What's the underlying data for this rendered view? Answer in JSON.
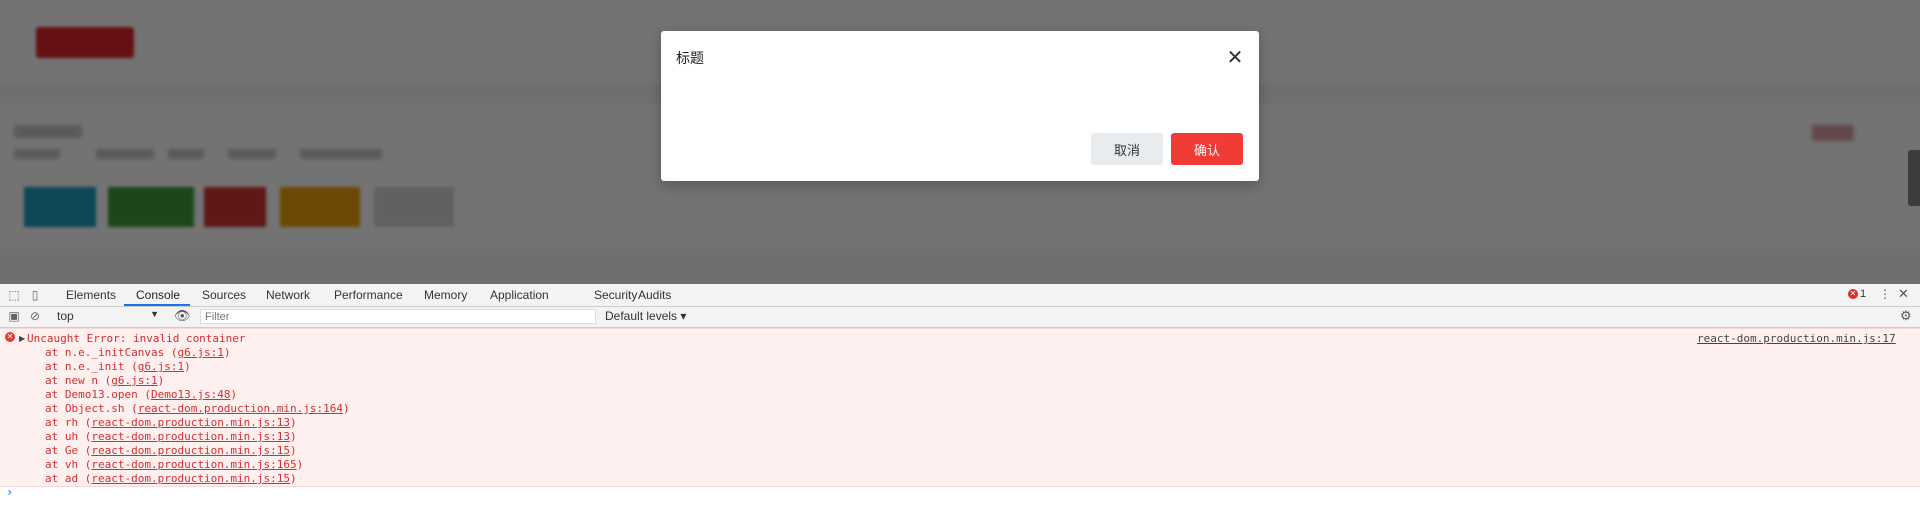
{
  "modal": {
    "title": "标题",
    "close_icon": "close-icon",
    "cancel_label": "取消",
    "ok_label": "确认",
    "ok_color": "#f03b36"
  },
  "devtools": {
    "tabs": [
      "Elements",
      "Console",
      "Sources",
      "Network",
      "Performance",
      "Memory",
      "Application",
      "Security",
      "Audits"
    ],
    "active_tab": "Console",
    "error_count": "1",
    "context": "top",
    "filter_placeholder": "Filter",
    "levels": "Default levels ▾",
    "error": {
      "message": "Uncaught Error: invalid container",
      "source": "react-dom.production.min.js:17",
      "stack": [
        {
          "prefix": "at n.e._initCanvas (",
          "link": "g6.js:1",
          "suffix": ")"
        },
        {
          "prefix": "at n.e._init (",
          "link": "g6.js:1",
          "suffix": ")"
        },
        {
          "prefix": "at new n (",
          "link": "g6.js:1",
          "suffix": ")"
        },
        {
          "prefix": "at Demo13.open (",
          "link": "Demo13.js:48",
          "suffix": ")"
        },
        {
          "prefix": "at Object.sh (",
          "link": "react-dom.production.min.js:164",
          "suffix": ")"
        },
        {
          "prefix": "at rh (",
          "link": "react-dom.production.min.js:13",
          "suffix": ")"
        },
        {
          "prefix": "at uh (",
          "link": "react-dom.production.min.js:13",
          "suffix": ")"
        },
        {
          "prefix": "at Ge (",
          "link": "react-dom.production.min.js:15",
          "suffix": ")"
        },
        {
          "prefix": "at vh (",
          "link": "react-dom.production.min.js:165",
          "suffix": ")"
        },
        {
          "prefix": "at ad (",
          "link": "react-dom.production.min.js:15",
          "suffix": ")"
        }
      ]
    },
    "prompt": "›"
  }
}
